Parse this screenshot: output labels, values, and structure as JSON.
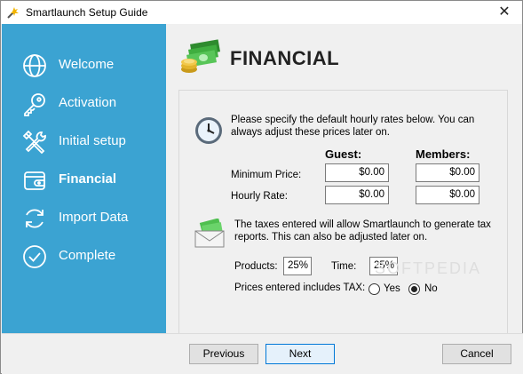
{
  "window": {
    "title": "Smartlaunch Setup Guide",
    "close_glyph": "✕"
  },
  "sidebar": {
    "accent_color": "#3ba3d2",
    "items": [
      {
        "label": "Welcome",
        "icon": "globe-icon",
        "active": false
      },
      {
        "label": "Activation",
        "icon": "key-icon",
        "active": false
      },
      {
        "label": "Initial setup",
        "icon": "tools-icon",
        "active": false
      },
      {
        "label": "Financial",
        "icon": "wallet-icon",
        "active": true
      },
      {
        "label": "Import Data",
        "icon": "sync-icon",
        "active": false
      },
      {
        "label": "Complete",
        "icon": "check-circle-icon",
        "active": false
      }
    ]
  },
  "page": {
    "title": "FINANCIAL",
    "icon": "money-stack-icon"
  },
  "rates": {
    "intro": "Please specify the default hourly rates below. You can always adjust these prices later on.",
    "guest_header": "Guest:",
    "members_header": "Members:",
    "min_price_label": "Minimum Price:",
    "hourly_rate_label": "Hourly Rate:",
    "guest_min_price": "$0.00",
    "members_min_price": "$0.00",
    "guest_hourly_rate": "$0.00",
    "members_hourly_rate": "$0.00"
  },
  "taxes": {
    "intro": "The taxes entered will allow Smartlaunch to generate tax reports. This can also be adjusted later on.",
    "products_label": "Products:",
    "products_value": "25%",
    "time_label": "Time:",
    "time_value": "25%",
    "includes_label": "Prices entered includes TAX:",
    "yes_label": "Yes",
    "no_label": "No",
    "selected": "No"
  },
  "watermark": "SOFTPEDIA",
  "footer": {
    "previous_label": "Previous",
    "next_label": "Next",
    "cancel_label": "Cancel"
  }
}
